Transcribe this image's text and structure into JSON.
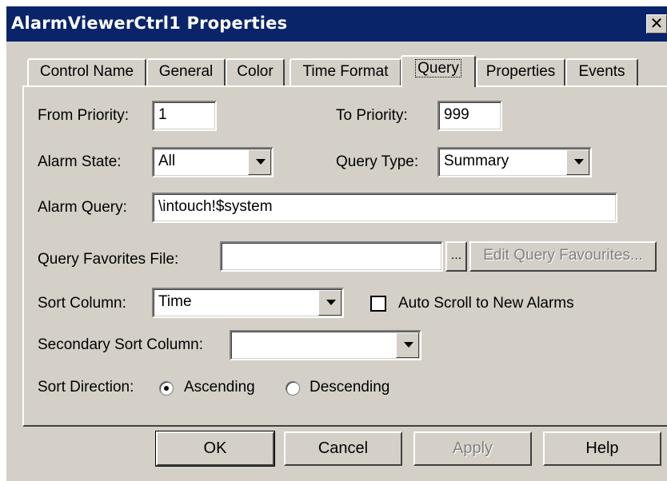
{
  "window": {
    "title": "AlarmViewerCtrl1 Properties",
    "close_glyph": "✕"
  },
  "tabs": [
    "Control Name",
    "General",
    "Color",
    "Time Format",
    "Query",
    "Properties",
    "Events"
  ],
  "active_tab": "Query",
  "form": {
    "from_priority_label": "From Priority:",
    "from_priority_value": "1",
    "to_priority_label": "To Priority:",
    "to_priority_value": "999",
    "alarm_state_label": "Alarm State:",
    "alarm_state_value": "All",
    "query_type_label": "Query Type:",
    "query_type_value": "Summary",
    "alarm_query_label": "Alarm Query:",
    "alarm_query_value": "\\intouch!$system",
    "favorites_label": "Query Favorites File:",
    "favorites_value": "",
    "browse_label": "...",
    "edit_favourites_label": "Edit Query Favourites...",
    "sort_column_label": "Sort Column:",
    "sort_column_value": "Time",
    "auto_scroll_label": "Auto Scroll to New Alarms",
    "auto_scroll_checked": false,
    "secondary_sort_label": "Secondary Sort Column:",
    "secondary_sort_value": "",
    "sort_direction_label": "Sort Direction:",
    "ascending_label": "Ascending",
    "descending_label": "Descending",
    "sort_direction_value": "Ascending"
  },
  "buttons": {
    "ok": "OK",
    "cancel": "Cancel",
    "apply": "Apply",
    "help": "Help"
  }
}
